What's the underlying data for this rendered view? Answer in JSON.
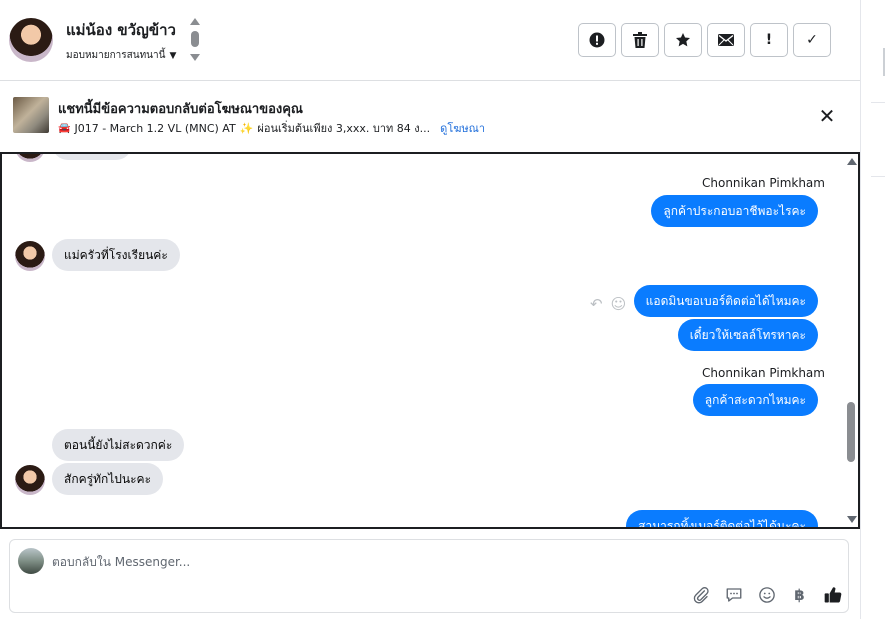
{
  "header": {
    "contact_name": "แม่น้อง ขวัญข้าว",
    "assign_label": "มอบหมายการสนทนานี้",
    "actions": [
      {
        "name": "spam-button",
        "icon": "alert-circle-icon"
      },
      {
        "name": "delete-button",
        "icon": "trash-icon"
      },
      {
        "name": "star-button",
        "icon": "star-icon"
      },
      {
        "name": "mark-unread-button",
        "icon": "envelope-icon"
      },
      {
        "name": "follow-up-button",
        "icon": "exclamation-icon",
        "glyph": "!"
      },
      {
        "name": "done-button",
        "icon": "check-icon",
        "glyph": "✓"
      }
    ]
  },
  "banner": {
    "title": "แชทนี้มีข้อความตอบกลับต่อโฆษณาของคุณ",
    "subtitle": "J017 - March 1.2 VL (MNC) AT",
    "subtitle_more": "ผ่อนเริ่มต้นเพียง 3,xxx. บาท 84 ง...",
    "link": "ดูโฆษณา",
    "close_glyph": "✕"
  },
  "conversation": {
    "messages": [
      {
        "dir": "out",
        "sender": "Chonnikan Pimkham",
        "text": "ลูกค้าประกอบอาชีพอะไรคะ"
      },
      {
        "dir": "in",
        "text": "แม่ครัวที่โรงเรียนค่ะ"
      },
      {
        "dir": "out",
        "text": "แอดมินขอเบอร์ติดต่อได้ไหมคะ"
      },
      {
        "dir": "out",
        "text": "เดี๋ยวให้เซลล์โทรหาคะ"
      },
      {
        "dir": "out",
        "sender": "Chonnikan Pimkham",
        "text": "ลูกค้าสะดวกไหมคะ"
      },
      {
        "dir": "in",
        "text": "ตอนนี้ยังไม่สะดวกค่ะ"
      },
      {
        "dir": "in",
        "text": "สักครู่ทักไปนะคะ"
      },
      {
        "dir": "out",
        "text": "สามารถทิ้งเบอร์ติดต่อไว้ได้นะคะ"
      }
    ]
  },
  "composer": {
    "placeholder": "ตอบกลับใน Messenger...",
    "tools": [
      {
        "name": "attach-icon",
        "glyph": "📎"
      },
      {
        "name": "saved-replies-icon",
        "glyph": "💬"
      },
      {
        "name": "emoji-icon",
        "glyph": "☺"
      },
      {
        "name": "payment-icon",
        "glyph": "฿"
      },
      {
        "name": "like-icon",
        "glyph": "👍"
      }
    ]
  },
  "colors": {
    "outgoing_bubble": "#0a7cff",
    "incoming_bubble": "#e4e6eb",
    "link": "#216fdb"
  }
}
